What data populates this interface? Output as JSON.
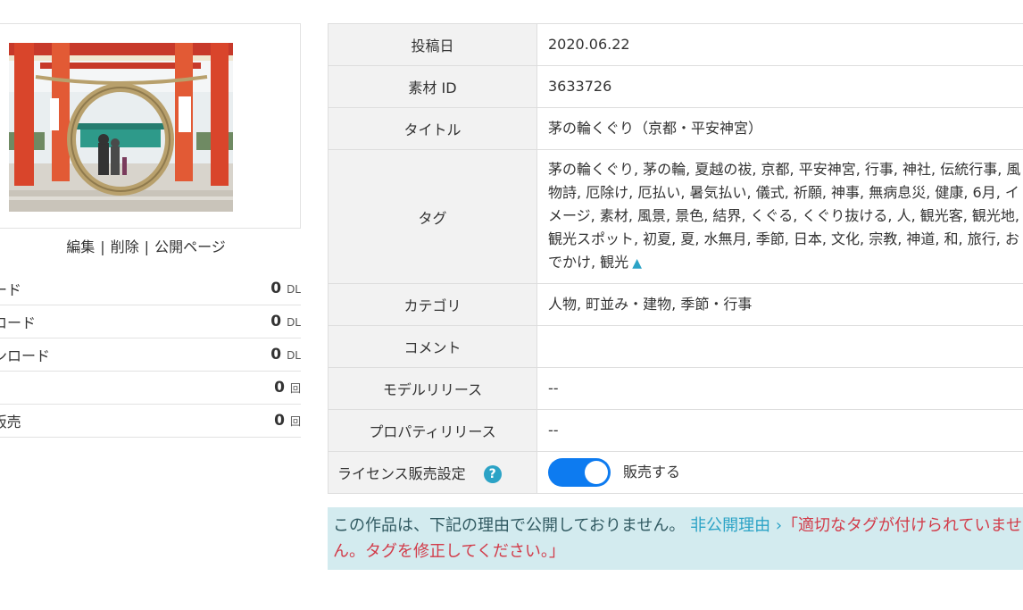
{
  "thumbnail": {
    "icon": "torii-shrine-photo",
    "colors": {
      "pillar": "#d9452b",
      "roof": "#c7392a",
      "wreath": "#b8a06c"
    }
  },
  "actions": {
    "edit": "編集",
    "delete": "削除",
    "public_page": "公開ページ",
    "separator": "|"
  },
  "stats": [
    {
      "label": "ンロード",
      "value": "0",
      "unit": "DL"
    },
    {
      "label": "ウンロード",
      "value": "0",
      "unit": "DL"
    },
    {
      "label": "ダウンロード",
      "value": "0",
      "unit": "DL"
    },
    {
      "label": "",
      "value": "0",
      "unit": "回"
    },
    {
      "label": "ンス販売",
      "value": "0",
      "unit": "回"
    }
  ],
  "detail": {
    "post_date_label": "投稿日",
    "post_date": "2020.06.22",
    "material_id_label": "素材 ID",
    "material_id": "3633726",
    "title_label": "タイトル",
    "title": "茅の輪くぐり（京都・平安神宮）",
    "tags_label": "タグ",
    "tags": "茅の輪くぐり, 茅の輪, 夏越の祓, 京都, 平安神宮, 行事, 神社, 伝統行事, 風物詩, 厄除け, 厄払い, 暑気払い, 儀式, 祈願, 神事, 無病息災, 健康, 6月, イメージ, 素材, 風景, 景色, 結界, くぐる, くぐり抜ける, 人, 観光客, 観光地, 観光スポット, 初夏, 夏, 水無月, 季節, 日本, 文化, 宗教, 神道, 和, 旅行, おでかけ, 観光",
    "tags_toggle": "▲",
    "category_label": "カテゴリ",
    "category": "人物, 町並み・建物, 季節・行事",
    "comment_label": "コメント",
    "comment": "",
    "model_release_label": "モデルリリース",
    "model_release": "--",
    "property_release_label": "プロパティリリース",
    "property_release": "--",
    "license_label": "ライセンス販売設定",
    "license_help": "?",
    "license_toggle_on": true,
    "license_toggle_label": "販売する"
  },
  "notice": {
    "text": "この作品は、下記の理由で公開しておりません。",
    "link": "非公開理由 ›",
    "reason": "「適切なタグが付けられていません。タグを修正してください。」",
    "colors": {
      "background": "#d3ebef",
      "link": "#2ca3c6",
      "reason": "#d23c4a"
    }
  }
}
